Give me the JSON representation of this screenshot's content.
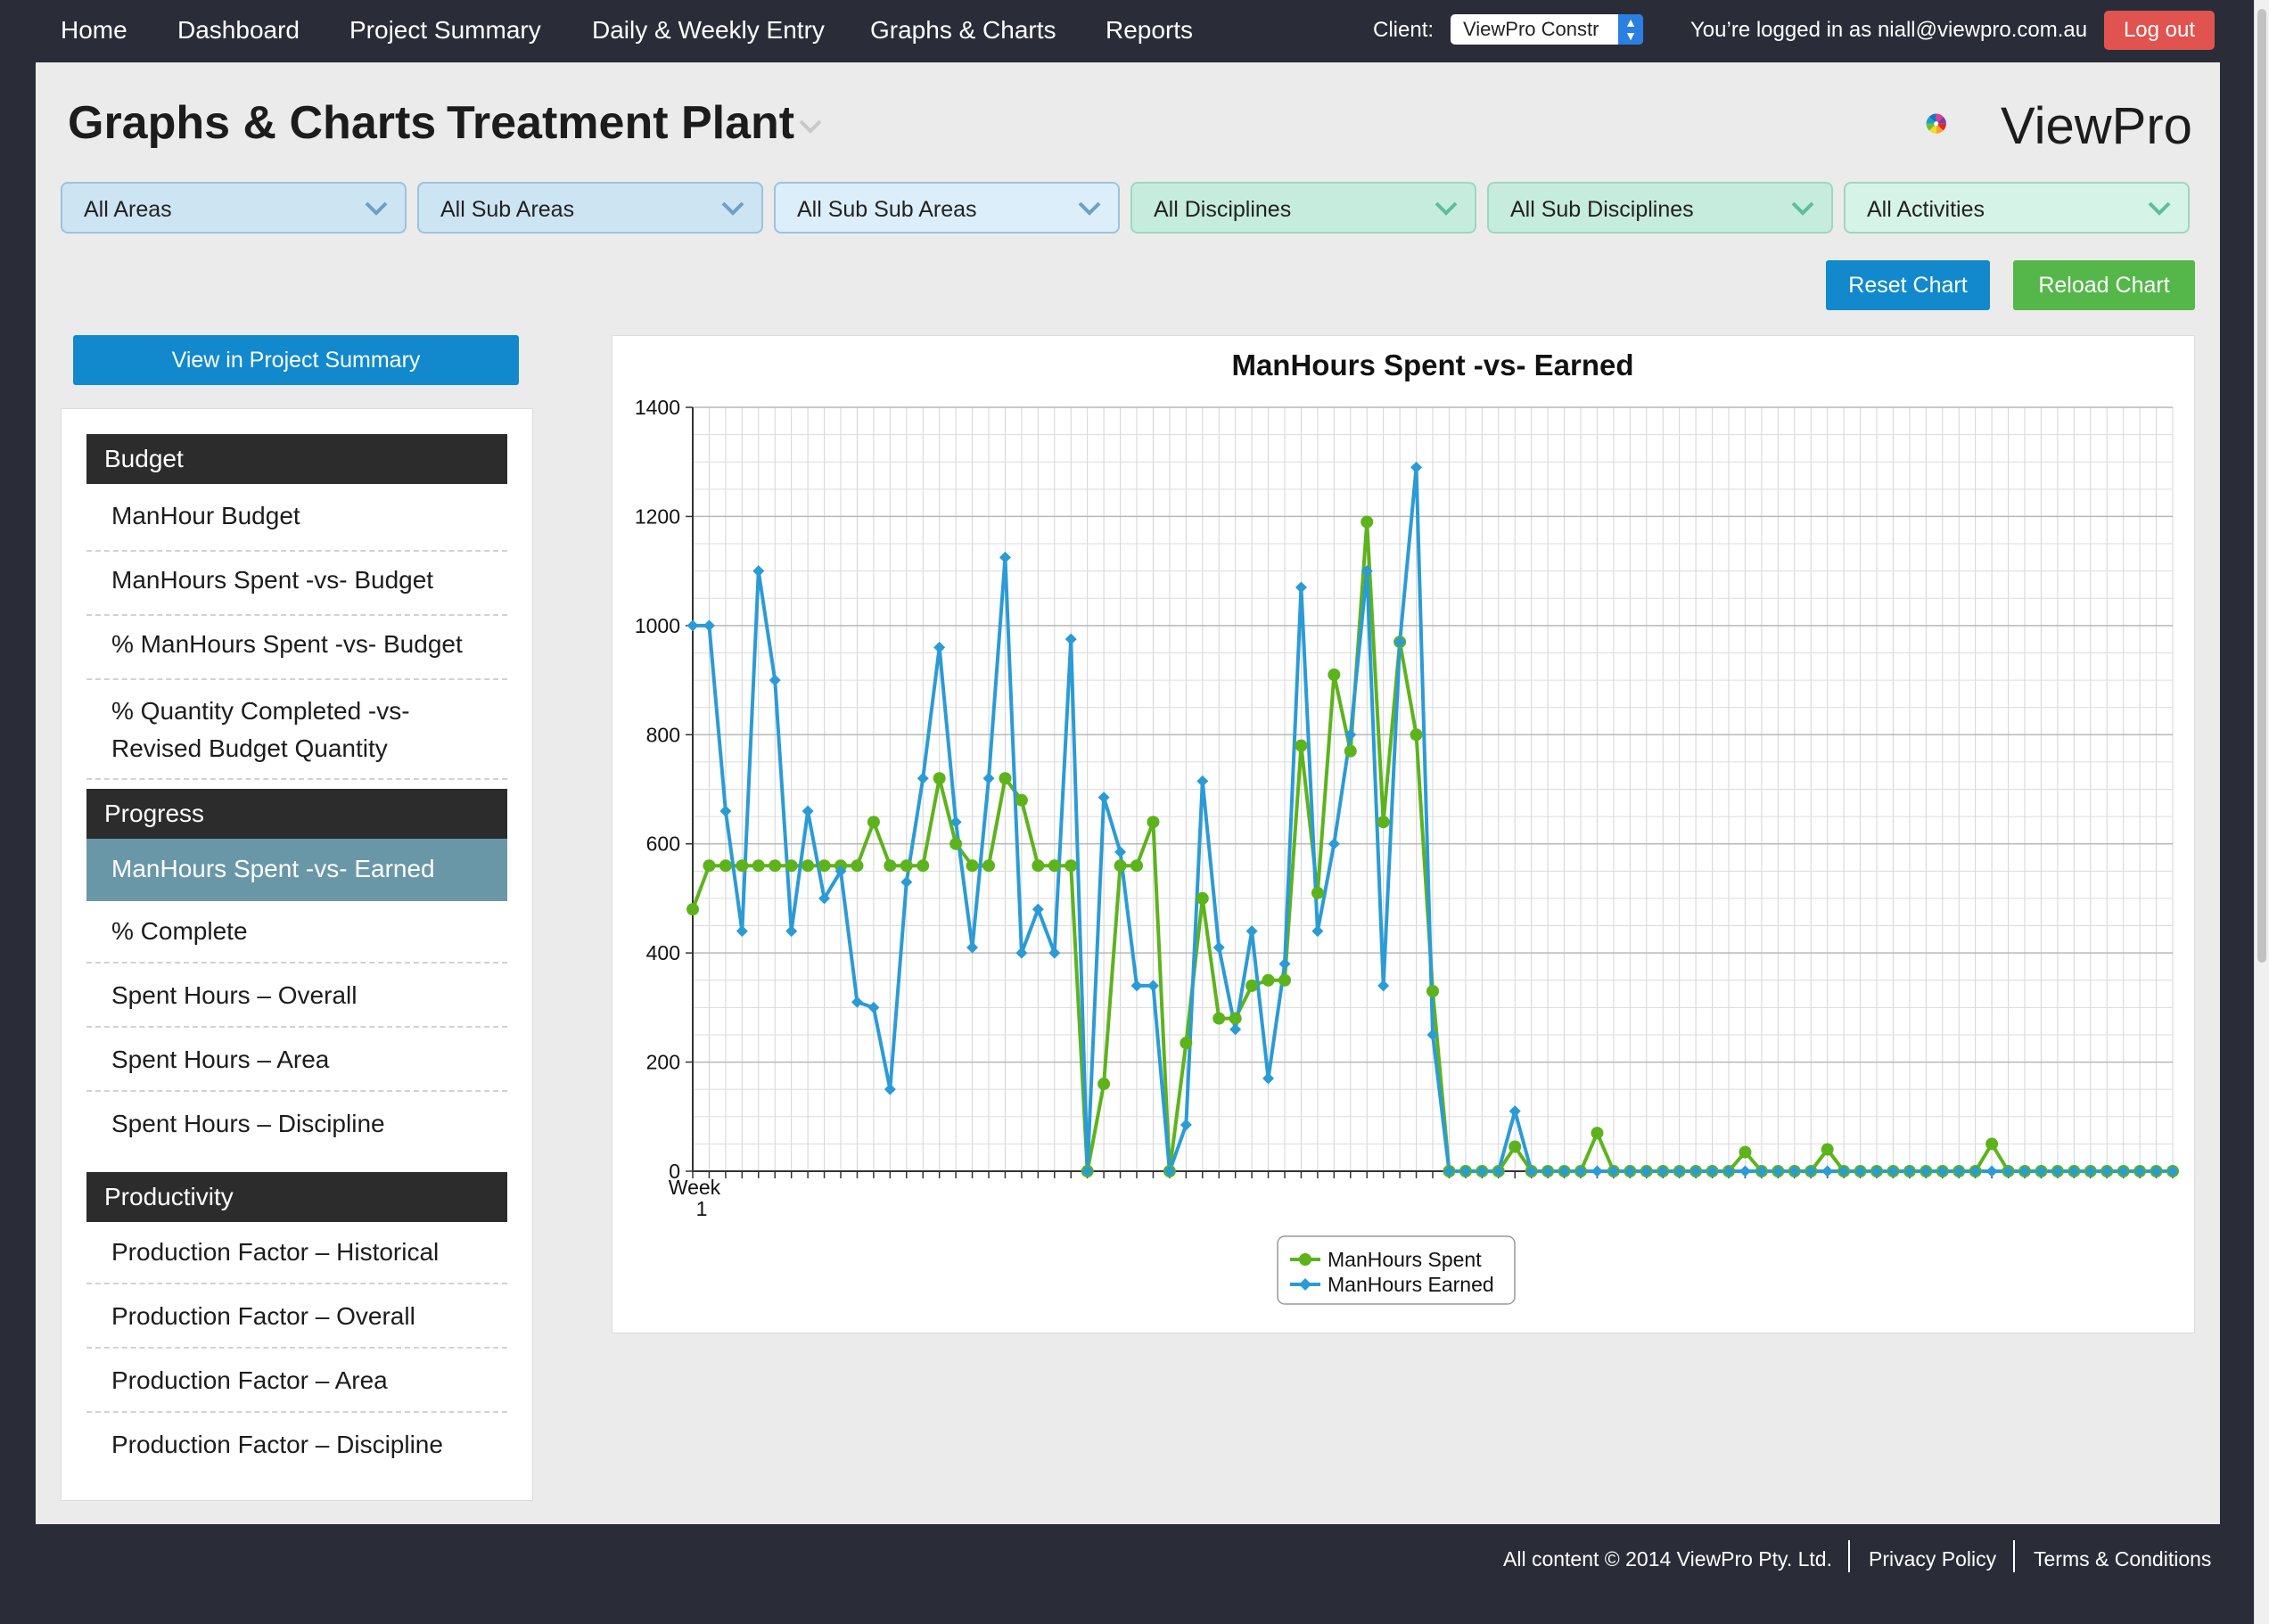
{
  "nav": {
    "items": [
      "Home",
      "Dashboard",
      "Project Summary",
      "Daily & Weekly Entry",
      "Graphs & Charts",
      "Reports"
    ],
    "client_label": "Client:",
    "client_value": "ViewPro Constr",
    "logged_in": "You’re logged in as niall@viewpro.com.au",
    "logout": "Log out"
  },
  "header": {
    "title": "Graphs & Charts",
    "project": "Treatment Plant",
    "logo_text": "ViewPro"
  },
  "filters": [
    "All Areas",
    "All Sub Areas",
    "All Sub Sub Areas",
    "All Disciplines",
    "All Sub Disciplines",
    "All Activities"
  ],
  "buttons": {
    "reset": "Reset Chart",
    "reload": "Reload Chart",
    "view_summary": "View in Project Summary"
  },
  "sidebar": {
    "budget": {
      "heading": "Budget",
      "items": [
        "ManHour Budget",
        "ManHours Spent -vs- Budget",
        "% ManHours Spent -vs- Budget",
        "% Quantity Completed -vs- Revised Budget Quantity"
      ]
    },
    "progress": {
      "heading": "Progress",
      "items": [
        "ManHours Spent -vs- Earned",
        "% Complete",
        "Spent Hours – Overall",
        "Spent Hours – Area",
        "Spent Hours – Discipline"
      ],
      "active": "ManHours Spent -vs- Earned"
    },
    "productivity": {
      "heading": "Productivity",
      "items": [
        "Production Factor – Historical",
        "Production Factor – Overall",
        "Production Factor – Area",
        "Production Factor – Discipline"
      ]
    }
  },
  "chart_data": {
    "type": "line",
    "title": "ManHours Spent -vs- Earned",
    "x_first_label": [
      "Week",
      "1"
    ],
    "ylim": [
      0,
      1400
    ],
    "yticks": [
      0,
      200,
      400,
      600,
      800,
      1000,
      1200,
      1400
    ],
    "grid": true,
    "legend_position": "bottom-center",
    "series": [
      {
        "name": "ManHours Spent",
        "color": "#5db31c",
        "marker": "circle",
        "values": [
          480,
          560,
          560,
          560,
          560,
          560,
          560,
          560,
          560,
          560,
          560,
          640,
          560,
          560,
          560,
          720,
          600,
          560,
          560,
          720,
          680,
          560,
          560,
          560,
          0,
          160,
          560,
          560,
          640,
          0,
          235,
          500,
          280,
          280,
          340,
          350,
          350,
          780,
          510,
          910,
          770,
          1190,
          640,
          970,
          800,
          330,
          0,
          0,
          0,
          0,
          45,
          0,
          0,
          0,
          0,
          70,
          0,
          0,
          0,
          0,
          0,
          0,
          0,
          0,
          35,
          0,
          0,
          0,
          0,
          40,
          0,
          0,
          0,
          0,
          0,
          0,
          0,
          0,
          0,
          50,
          0,
          0,
          0,
          0,
          0,
          0,
          0,
          0,
          0,
          0,
          0
        ]
      },
      {
        "name": "ManHours Earned",
        "color": "#2b9bd6",
        "marker": "diamond",
        "values": [
          1000,
          1000,
          660,
          440,
          1100,
          900,
          440,
          660,
          500,
          550,
          310,
          300,
          150,
          530,
          720,
          960,
          640,
          410,
          720,
          1125,
          400,
          480,
          400,
          975,
          0,
          685,
          585,
          340,
          340,
          0,
          85,
          715,
          410,
          260,
          440,
          170,
          380,
          1070,
          440,
          600,
          800,
          1100,
          340,
          970,
          1290,
          250,
          0,
          0,
          0,
          0,
          110,
          0,
          0,
          0,
          0,
          0,
          0,
          0,
          0,
          0,
          0,
          0,
          0,
          0,
          0,
          0,
          0,
          0,
          0,
          0,
          0,
          0,
          0,
          0,
          0,
          0,
          0,
          0,
          0,
          0,
          0,
          0,
          0,
          0,
          0,
          0,
          0,
          0,
          0,
          0,
          0
        ]
      }
    ]
  },
  "footer": {
    "copyright": "All content © 2014 ViewPro Pty. Ltd.",
    "privacy": "Privacy Policy",
    "terms": "Terms & Conditions"
  }
}
